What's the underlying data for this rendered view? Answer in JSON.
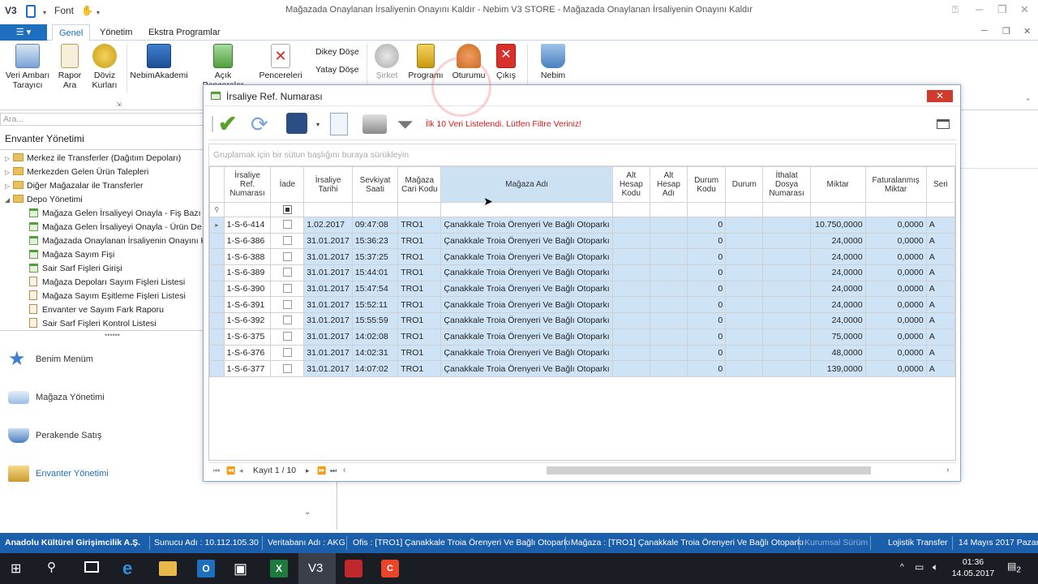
{
  "window": {
    "title": "Mağazada Onaylanan İrsaliyenin Onayını Kaldır - Nebim V3 STORE - Mağazada Onaylanan İrsaliyenin Onayını Kaldır",
    "qat_font_label": "Font"
  },
  "ribbon": {
    "tabs": [
      "Genel",
      "Yönetim",
      "Ekstra Programlar"
    ],
    "buttons": {
      "veri_ambari": "Veri Ambarı Tarayıcı",
      "rapor_ara": "Rapor Ara",
      "doviz_kurlari": "Döviz Kurları",
      "nebim_akademi": "NebimAkademi",
      "acik_pencereler": "Açık Pencereler",
      "pencereleri": "Pencereleri",
      "dikey_dose": "Dikey Döşe",
      "yatay_dose": "Yatay Döşe",
      "sirket": "Şirket",
      "programi": "Programı",
      "oturumu": "Oturumu",
      "cikis": "Çıkış",
      "nebim": "Nebim"
    }
  },
  "left_panel": {
    "search_placeholder": "Ara...",
    "title": "Envanter Yönetimi",
    "tree": [
      {
        "label": "Merkez ile Transferler (Dağıtım Depoları)",
        "type": "folder",
        "level": 0
      },
      {
        "label": "Merkezden Gelen Ürün Talepleri",
        "type": "folder",
        "level": 0
      },
      {
        "label": "Diğer Mağazalar ile Transferler",
        "type": "folder",
        "level": 0
      },
      {
        "label": "Depo Yönetimi",
        "type": "folder-open",
        "level": 0
      },
      {
        "label": "Mağaza Gelen İrsaliyeyi Onayla - Fiş Bazı",
        "type": "form",
        "level": 1
      },
      {
        "label": "Mağaza Gelen İrsaliyeyi Onayla - Ürün De",
        "type": "form",
        "level": 1
      },
      {
        "label": "Mağazada Onaylanan İrsaliyenin Onayını Ka",
        "type": "form",
        "level": 1
      },
      {
        "label": "Mağaza Sayım Fişi",
        "type": "form",
        "level": 1
      },
      {
        "label": "Sair Sarf Fişleri Girişi",
        "type": "form",
        "level": 1
      },
      {
        "label": "Mağaza Depoları Sayım Fişleri Listesi",
        "type": "doc",
        "level": 1
      },
      {
        "label": "Mağaza Sayım Eşitleme Fişleri Listesi",
        "type": "doc",
        "level": 1
      },
      {
        "label": "Envanter ve Sayım Fark Raporu",
        "type": "doc",
        "level": 1
      },
      {
        "label": "Sair Sarf Fişleri Kontrol Listesi",
        "type": "doc",
        "level": 1
      }
    ],
    "nav": [
      "Benim Menüm",
      "Mağaza Yönetimi",
      "Perakende Satış",
      "Envanter Yönetimi"
    ]
  },
  "dialog": {
    "title": "İrsaliye Ref. Numarası",
    "warning": "İlk 10 Veri Listelendi. Lütfen Filtre Veriniz!",
    "group_hint": "Gruplamak için bir sütun başlığını buraya sürükleyin",
    "columns": [
      "İrsaliye Ref. Numarası",
      "İade",
      "İrsaliye Tarihi",
      "Sevkiyat Saati",
      "Mağaza Cari Kodu",
      "Mağaza Adı",
      "Alt Hesap Kodu",
      "Alt Hesap Adı",
      "Durum Kodu",
      "Durum",
      "İthalat Dosya Numarası",
      "Miktar",
      "Faturalanmış Miktar",
      "Seri"
    ],
    "rows": [
      [
        "1-S-6-414",
        "",
        "1.02.2017",
        "09:47:08",
        "TRO1",
        "Çanakkale Troia Örenyeri Ve Bağlı Otoparkı",
        "",
        "",
        "0",
        "",
        "",
        "10.750,0000",
        "0,0000",
        "A"
      ],
      [
        "1-S-6-386",
        "",
        "31.01.2017",
        "15:36:23",
        "TRO1",
        "Çanakkale Troia Örenyeri Ve Bağlı Otoparkı",
        "",
        "",
        "0",
        "",
        "",
        "24,0000",
        "0,0000",
        "A"
      ],
      [
        "1-S-6-388",
        "",
        "31.01.2017",
        "15:37:25",
        "TRO1",
        "Çanakkale Troia Örenyeri Ve Bağlı Otoparkı",
        "",
        "",
        "0",
        "",
        "",
        "24,0000",
        "0,0000",
        "A"
      ],
      [
        "1-S-6-389",
        "",
        "31.01.2017",
        "15:44:01",
        "TRO1",
        "Çanakkale Troia Örenyeri Ve Bağlı Otoparkı",
        "",
        "",
        "0",
        "",
        "",
        "24,0000",
        "0,0000",
        "A"
      ],
      [
        "1-S-6-390",
        "",
        "31.01.2017",
        "15:47:54",
        "TRO1",
        "Çanakkale Troia Örenyeri Ve Bağlı Otoparkı",
        "",
        "",
        "0",
        "",
        "",
        "24,0000",
        "0,0000",
        "A"
      ],
      [
        "1-S-6-391",
        "",
        "31.01.2017",
        "15:52:11",
        "TRO1",
        "Çanakkale Troia Örenyeri Ve Bağlı Otoparkı",
        "",
        "",
        "0",
        "",
        "",
        "24,0000",
        "0,0000",
        "A"
      ],
      [
        "1-S-6-392",
        "",
        "31.01.2017",
        "15:55:59",
        "TRO1",
        "Çanakkale Troia Örenyeri Ve Bağlı Otoparkı",
        "",
        "",
        "0",
        "",
        "",
        "24,0000",
        "0,0000",
        "A"
      ],
      [
        "1-S-6-375",
        "",
        "31.01.2017",
        "14:02:08",
        "TRO1",
        "Çanakkale Troia Örenyeri Ve Bağlı Otoparkı",
        "",
        "",
        "0",
        "",
        "",
        "75,0000",
        "0,0000",
        "A"
      ],
      [
        "1-S-6-376",
        "",
        "31.01.2017",
        "14:02:31",
        "TRO1",
        "Çanakkale Troia Örenyeri Ve Bağlı Otoparkı",
        "",
        "",
        "0",
        "",
        "",
        "48,0000",
        "0,0000",
        "A"
      ],
      [
        "1-S-6-377",
        "",
        "31.01.2017",
        "14:07:02",
        "TRO1",
        "Çanakkale Troia Örenyeri Ve Bağlı Otoparkı",
        "",
        "",
        "0",
        "",
        "",
        "139,0000",
        "0,0000",
        "A"
      ]
    ],
    "record_label": "Kayıt 1 / 10"
  },
  "status_bar": {
    "company": "Anadolu Kültürel Girişimcilik A.Ş.",
    "server": "Sunucu Adı : 10.112.105.30",
    "db": "Veritabanı Adı : AKG",
    "office": "Ofis : [TRO1]  Çanakkale Troia Örenyeri Ve Bağlı Otoparkı",
    "store": "Mağaza : [TRO1]  Çanakkale Troia Örenyeri Ve Bağlı Otoparkı",
    "version": "Kurumsal Sürüm",
    "transfer": "Lojistik Transfer",
    "date": "14 Mayıs 2017 Pazar"
  },
  "taskbar": {
    "time": "01:36",
    "date": "14.05.2017",
    "notif": "2"
  },
  "colors": {
    "accent": "#1e6fc0",
    "status_bg": "#1b5fab",
    "row_bg": "#cfe3f7",
    "warning": "#d11c1c",
    "close": "#d13b2c"
  }
}
